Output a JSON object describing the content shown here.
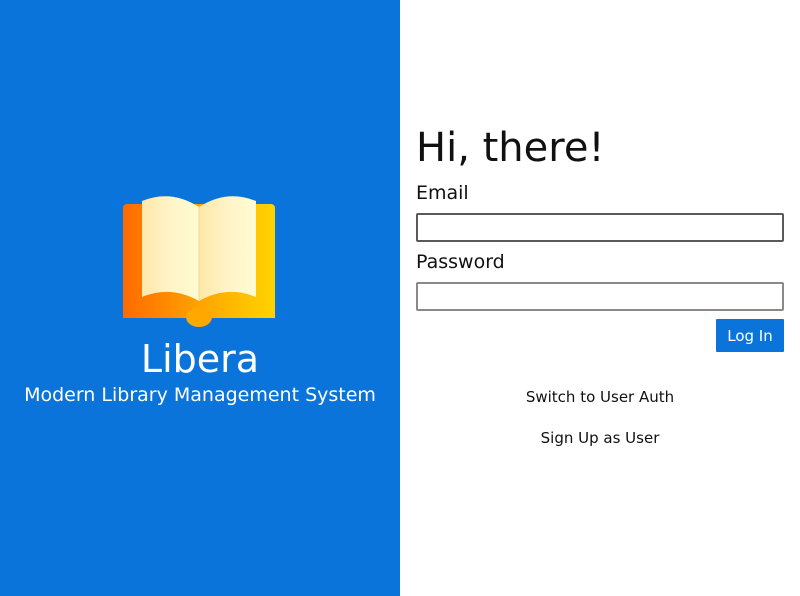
{
  "brand": {
    "name": "Libera",
    "tagline": "Modern Library Management System",
    "logo_icon": "open-book-icon",
    "panel_color": "#0a74da"
  },
  "login_form": {
    "greeting": "Hi, there!",
    "email_label": "Email",
    "email_value": "",
    "password_label": "Password",
    "password_value": "",
    "submit_label": "Log In",
    "accent_color": "#0a74da"
  },
  "links": {
    "switch_auth": "Switch to User Auth",
    "sign_up": "Sign Up as User"
  }
}
